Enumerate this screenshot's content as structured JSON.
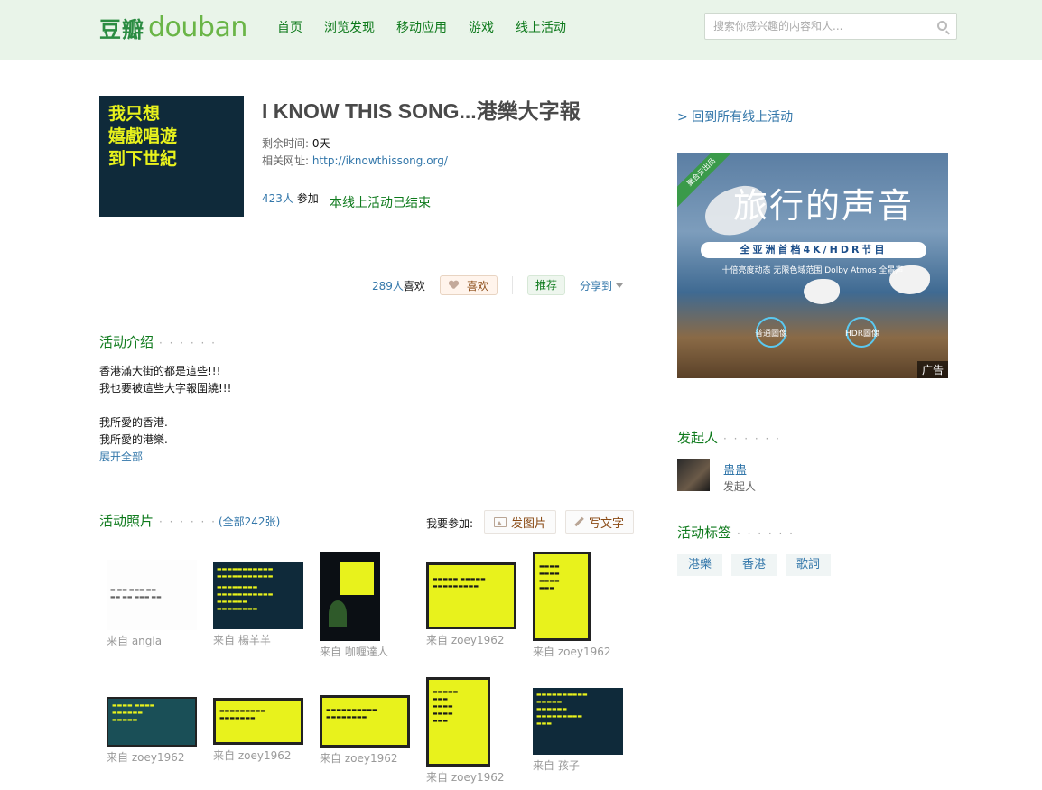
{
  "header": {
    "logo_cn": "豆瓣",
    "logo_en": "douban",
    "nav": [
      "首页",
      "浏览发现",
      "移动应用",
      "游戏",
      "线上活动"
    ],
    "search_placeholder": "搜索你感兴趣的内容和人..."
  },
  "event": {
    "poster_lines": [
      "我只想",
      "嬉戲唱遊",
      "到下世紀"
    ],
    "title": "I KNOW THIS SONG...港樂大字報",
    "remaining_label": "剩余时间:",
    "remaining_value": "0天",
    "url_label": "相关网址:",
    "url": "http://iknowthissong.org/",
    "participants_count": "423人",
    "participants_suffix": "参加",
    "status": "本线上活动已结束"
  },
  "actions": {
    "likes_count": "289人",
    "likes_suffix": "喜欢",
    "like_button": "喜欢",
    "recommend_button": "推荐",
    "share_label": "分享到"
  },
  "intro": {
    "heading": "活动介绍",
    "dots": "· · · · · ·",
    "lines": [
      "香港滿大街的都是這些!!!",
      "我也要被這些大字報圍繞!!!",
      "",
      "我所愛的香港.",
      "我所愛的港樂."
    ],
    "expand_link": "展开全部"
  },
  "photos": {
    "heading": "活动照片",
    "dots": "· · · · · ·",
    "total": "(全部242张)",
    "join_label": "我要参加:",
    "upload_image": "发图片",
    "write_text": "写文字",
    "items": [
      {
        "from": "来自 angla"
      },
      {
        "from": "来自 楊羊羊"
      },
      {
        "from": "来自 咖喱達人"
      },
      {
        "from": "来自 zoey1962"
      },
      {
        "from": "来自 zoey1962"
      },
      {
        "from": "来自 zoey1962"
      },
      {
        "from": "来自 zoey1962"
      },
      {
        "from": "来自 zoey1962"
      },
      {
        "from": "来自 zoey1962"
      },
      {
        "from": "来自 孩子"
      }
    ]
  },
  "sidebar": {
    "back_link": "> 回到所有线上活动",
    "ad": {
      "ribbon": "聚合云出品",
      "title": "旅行的声音",
      "bar": "全亚洲首档4K/HDR节目",
      "subtitle": "十倍亮度动态 无限色域范围 Dolby Atmos 全景声",
      "left_label": "普通圖像",
      "right_label": "HDR圖像",
      "tag": "广告"
    },
    "creator_heading": "发起人",
    "creator_dots": "· · · · · ·",
    "creator_name": "蛊蛊",
    "creator_role": "发起人",
    "tags_heading": "活动标签",
    "tags_dots": "· · · · · ·",
    "tags": [
      "港樂",
      "香港",
      "歌詞"
    ]
  },
  "colors": {
    "header_bg": "#e9f4e9",
    "nav_green": "#0e7a1c",
    "link_blue": "#3377aa",
    "poster_bg": "#0f2a3a",
    "poster_text": "#e8f21c"
  }
}
